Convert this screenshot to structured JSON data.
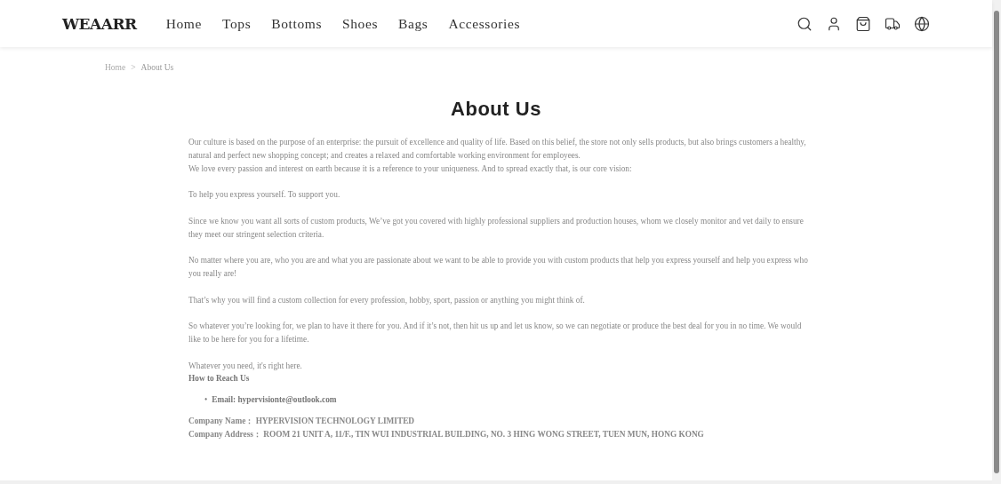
{
  "header": {
    "logo": "WEAARR",
    "nav": [
      "Home",
      "Tops",
      "Bottoms",
      "Shoes",
      "Bags",
      "Accessories"
    ]
  },
  "breadcrumb": {
    "items": [
      "Home",
      "About Us"
    ],
    "separator": ">"
  },
  "title": "About Us",
  "paragraphs": [
    {
      "lines": [
        "Our culture is based on the purpose of an enterprise: the pursuit of excellence and quality of life. Based on this belief, the store not only sells products, but also brings customers a healthy, natural and perfect new shopping concept; and creates a relaxed and comfortable working environment for employees.",
        "We love every passion and interest on earth because it is a reference to your uniqueness. And to spread exactly that, is our core vision:"
      ]
    },
    {
      "lines": [
        "To help you express yourself. To support you."
      ]
    },
    {
      "lines": [
        "Since we know you want all sorts of custom products, We’ve got you covered with highly professional suppliers and production houses, whom we closely monitor and vet daily to ensure they meet our stringent selection criteria."
      ]
    },
    {
      "lines": [
        "No matter where you are, who you are and what you are passionate about we want to be able to provide you with custom products that help you express yourself and help you express who you really are!"
      ]
    },
    {
      "lines": [
        "That’s why you will find a custom collection for every profession, hobby, sport, passion or anything you might think of."
      ]
    },
    {
      "lines": [
        "So whatever you’re looking for, we plan to have it there for you. And if it’s not, then hit us up and let us know, so we can negotiate or produce the best deal for you in no time. We would like to be here for you for a lifetime."
      ]
    }
  ],
  "contact": {
    "note": "Whatever you need, it's right here.",
    "heading": "How to Reach Us",
    "bullet": "•",
    "items": [
      "Email: hypervisionte@outlook.com"
    ],
    "fields": [
      {
        "label": "Company Name：",
        "value": "HYPERVISION TECHNOLOGY LIMITED"
      },
      {
        "label": "Company Address：",
        "value": "ROOM 21 UNIT A, 11/F., TIN WUI INDUSTRIAL BUILDING, NO. 3 HING WONG STREET, TUEN MUN, HONG KONG"
      }
    ]
  }
}
